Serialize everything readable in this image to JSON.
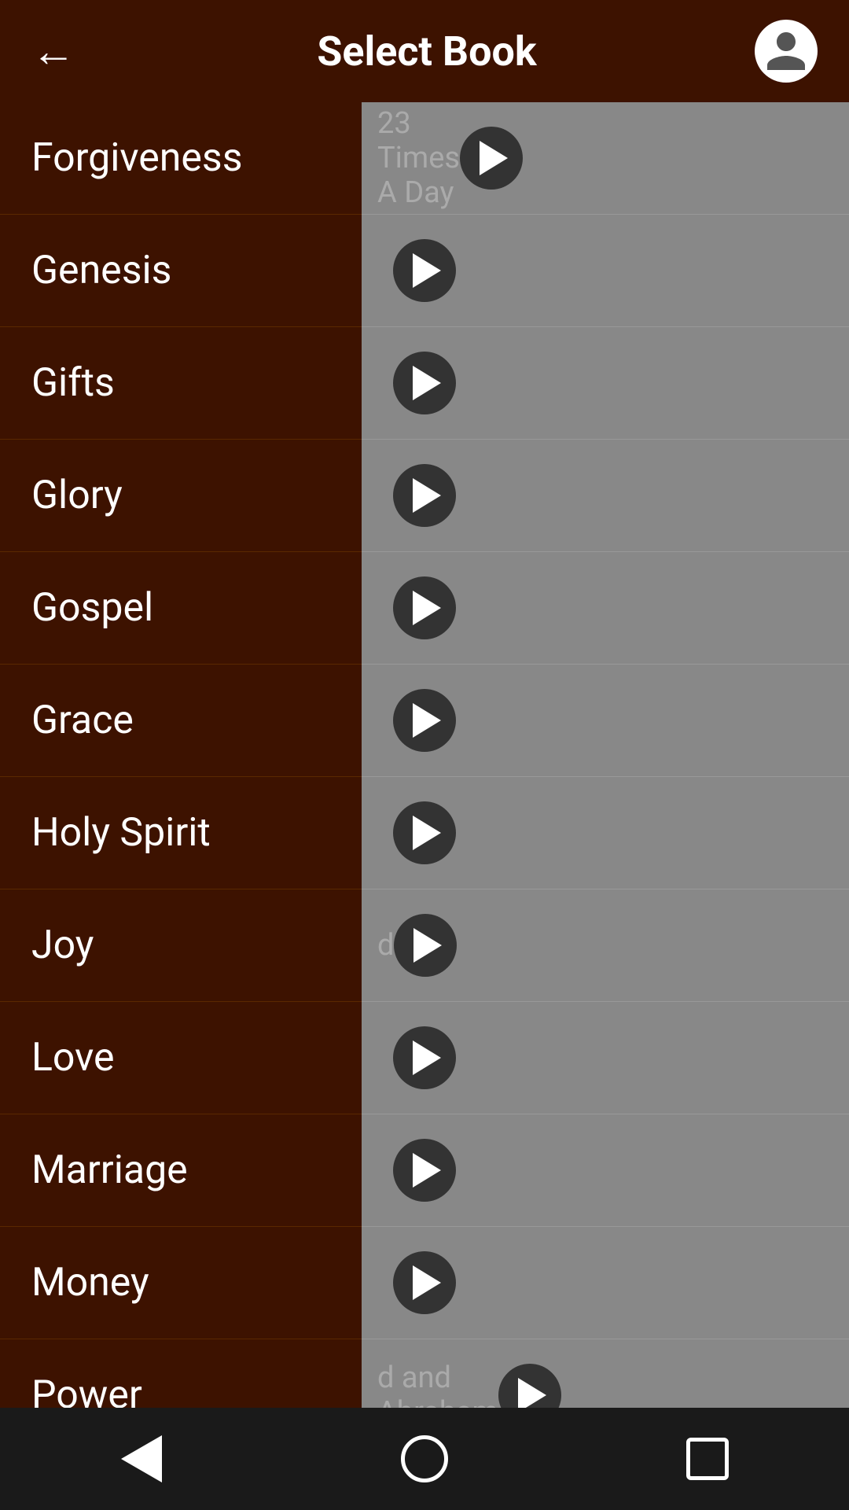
{
  "header": {
    "title": "Select Book",
    "back_label": "←"
  },
  "sidebar": {
    "items": [
      {
        "id": "forgiveness",
        "label": "Forgiveness"
      },
      {
        "id": "genesis",
        "label": "Genesis"
      },
      {
        "id": "gifts",
        "label": "Gifts"
      },
      {
        "id": "glory",
        "label": "Glory"
      },
      {
        "id": "gospel",
        "label": "Gospel"
      },
      {
        "id": "grace",
        "label": "Grace"
      },
      {
        "id": "holy-spirit",
        "label": "Holy Spirit"
      },
      {
        "id": "joy",
        "label": "Joy"
      },
      {
        "id": "love",
        "label": "Love"
      },
      {
        "id": "marriage",
        "label": "Marriage"
      },
      {
        "id": "money",
        "label": "Money"
      },
      {
        "id": "power",
        "label": "Power"
      }
    ]
  },
  "background_rows": [
    {
      "id": "row1",
      "text": "23 Times A Day"
    },
    {
      "id": "row2",
      "text": ""
    },
    {
      "id": "row3",
      "text": ""
    },
    {
      "id": "row4",
      "text": ""
    },
    {
      "id": "row5",
      "text": ""
    },
    {
      "id": "row6",
      "text": ""
    },
    {
      "id": "row7",
      "text": ""
    },
    {
      "id": "row8",
      "text": "d"
    },
    {
      "id": "row9",
      "text": ""
    },
    {
      "id": "row10",
      "text": ""
    },
    {
      "id": "row11",
      "text": ""
    },
    {
      "id": "row12",
      "text": "d and Abraham"
    }
  ],
  "navbar": {
    "back_label": "◁",
    "home_label": "○",
    "recent_label": "□"
  },
  "colors": {
    "header_bg": "#3d1200",
    "sidebar_bg": "#3d1200",
    "background_panel": "#888888",
    "nav_bg": "#1a1a1a"
  }
}
